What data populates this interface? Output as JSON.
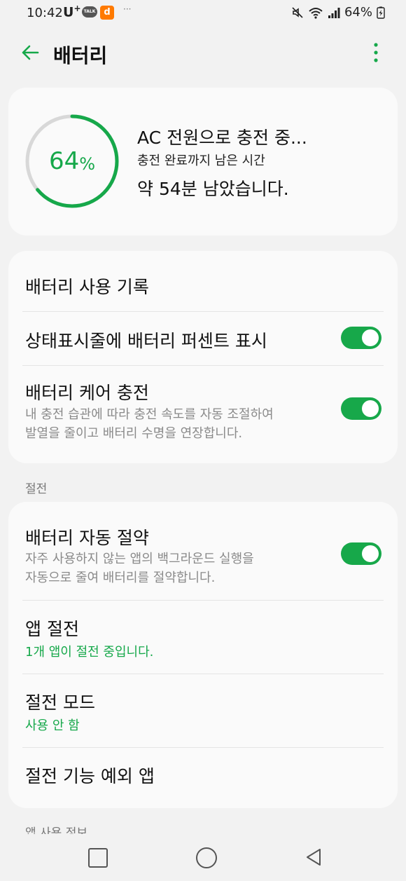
{
  "status_bar": {
    "time": "10:42",
    "carrier": "U",
    "carrier_sup": "+",
    "talk_badge": "TALK",
    "app_badge": "d",
    "more": "···",
    "battery_percent": "64%",
    "icons": [
      "mute-icon",
      "wifi-icon",
      "signal-icon",
      "battery-charging-icon"
    ]
  },
  "header": {
    "title": "배터리",
    "back_icon": "arrow-left-icon",
    "more_icon": "more-vertical-icon"
  },
  "battery": {
    "percent_value": 64,
    "percent_number": "64",
    "percent_sign": "%",
    "charge_status": "AC 전원으로 충전 중...",
    "remaining_label": "충전 완료까지 남은 시간",
    "remaining_value": "약 54분 남았습니다."
  },
  "settings": {
    "usage_history": "배터리 사용 기록",
    "status_bar_percent": {
      "title": "상태표시줄에 배터리 퍼센트 표시",
      "enabled": true
    },
    "battery_care": {
      "title": "배터리 케어 충전",
      "subtitle_line1": "내 충전 습관에 따라 충전 속도를 자동 조절하여",
      "subtitle_line2": "발열을 줄이고 배터리 수명을 연장합니다.",
      "enabled": true
    }
  },
  "power_saving": {
    "section_label": "절전",
    "auto_saver": {
      "title": "배터리 자동 절약",
      "subtitle_line1": "자주 사용하지 않는 앱의 백그라운드 실행을",
      "subtitle_line2": "자동으로 줄여 배터리를 절약합니다.",
      "enabled": true
    },
    "app_saving": {
      "title": "앱 절전",
      "subtitle": "1개 앱이 절전 중입니다."
    },
    "power_mode": {
      "title": "절전 모드",
      "subtitle": "사용 안 함"
    },
    "exceptions": {
      "title": "절전 기능 예외 앱"
    }
  },
  "next_section_label": "앱 사용 정보",
  "colors": {
    "accent": "#16a84a",
    "background": "#f2f2f2",
    "card": "#fafafa"
  },
  "navigation": [
    "recents-square-icon",
    "home-circle-icon",
    "back-triangle-icon"
  ]
}
